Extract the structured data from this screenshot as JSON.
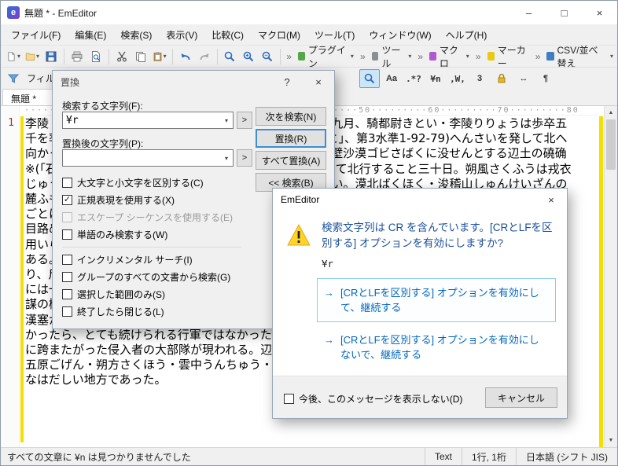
{
  "glyphs": {
    "caret": "▾",
    "chevron": "»",
    "help": "?",
    "close": "×",
    "minimize": "–",
    "maximize": "□",
    "check": "✓",
    "arrow": "→",
    "scroll_up": "▲",
    "scroll_down": "▼",
    "app_letter": "e"
  },
  "colors": {
    "accent_blue": "#3c8fd0",
    "instruction_blue": "#1a4f9c",
    "link_blue": "#0067c0",
    "warning_yellow": "#ffd32a",
    "modified_yellow": "#f3df00",
    "line_number_red": "#a33333"
  },
  "window": {
    "title": "無題 * - EmEditor"
  },
  "menu_bar": {
    "items": [
      "ファイル(F)",
      "編集(E)",
      "検索(S)",
      "表示(V)",
      "比較(C)",
      "マクロ(M)",
      "ツール(T)",
      "ウィンドウ(W)",
      "ヘルプ(H)"
    ]
  },
  "toolbar_main": {
    "labeled_buttons": [
      "プラグイン",
      "ツール",
      "マクロ",
      "マーカー",
      "CSV/並べ替え"
    ]
  },
  "toolbar_filter": {
    "label": "フィルター",
    "toggles": [
      "Aa",
      ".*?",
      "¥n",
      ",W,",
      "3",
      "↔",
      "¶"
    ]
  },
  "tab_bar": {
    "active_tab": "無題 *"
  },
  "editor": {
    "line_number": "1",
    "ruler": "·········10·········20·········30·········40·········50·········60·········70·········80",
    "text": "李陵 中島敦  一  漢かんの武帝ぶていの天漢てんかん二年秋九月、騎都尉きとい・李陵りりょうは歩卒五千を率ひきい、辺塞遮虜鄣しゃりょしょう※(「章+おおざと」、第3水準1-92-79)へんさいを発して北へ向かった。朔北の果て、阿爾泰アルタイ山脈の東南端が戈壁沙漠ゴビさばくに没せんとする辺土の磽确※(「石+角」、第3水準1-89-6)こうかくたる丘陵地帯を縫って北行すること三十日。朔風さくふうは戎衣じゅういを吹いて寒く、いかにも万里孤軍来たるの感が深い。漠北ばくほく・浚稽山しゅんけいざんの麓ふもとに到着すると、軍はそこに留とどまって営塁えいるいを築いた。北地の秋は既すでに深く、夜ごとに霜が降り、よく晴れた日には遥はるか北方に連なる山々の影が望まれた。営庭に立って望めば、目路めじの限り茫々ぼうぼうたる砂礫されきの海である。北辺の守りは薄く、烽火ほうかの台は久しく用いられなかった。わずか五千の歩卒を以もって騎馬戦を得意とする胡地こちの奥深くに侵入するのである。傍目はためには、これほど無謀な遠征はないと見えたであろう。いまや軍は敵地のただなかにあり、斥候は日ごとに遠く放たれた。情勢は予断を許さず、単于ぜんうの本隊の影はなお見えぬ。陵の軍には一頭の馬もなく(馬に跨またがる者は、陵とその幕僚のみ)、歩卒のみで行軍することからして、無謀の極きわみといわねばならぬ。後援はなく、しかもこの浚稽山しゅんけいざんからは、最寄もよりの漢塞かんさいからでも優に一千五百里(支那里程)はある。部下の信頼と峻厳しゅんげんたる軍律とがなかったら、とても続けられる行軍ではなかった。毎年秋風が立つと決きまって漢の北辺には、胡馬こばに跨またがった侵入者の大部隊が現われる。辺吏が殺され、人民が掠かすめられ、家畜が奪略される。五原ごげん・朔方さくほう・雲中うんちゅう・上谷じょうこく・雁門がんもんなどがその被害の最もはなはだしい地方であった。"
  },
  "replace_dialog": {
    "title": "置換",
    "find_label": "検索する文字列(F):",
    "find_value": "¥r",
    "replace_label": "置換後の文字列(P):",
    "replace_value": "",
    "expand_button": ">",
    "button_find_next": "次を検索(N)",
    "button_replace": "置換(R)",
    "button_replace_all": "すべて置換(A)",
    "button_collapse": "<< 検索(B)",
    "checkboxes": [
      {
        "label": "大文字と小文字を区別する(C)",
        "checked": false,
        "disabled": false
      },
      {
        "label": "正規表現を使用する(X)",
        "checked": true,
        "disabled": false
      },
      {
        "label": "エスケープ シーケンスを使用する(E)",
        "checked": false,
        "disabled": true
      },
      {
        "label": "単語のみ検索する(W)",
        "checked": false,
        "disabled": false
      },
      {
        "label": "インクリメンタル サーチ(I)",
        "checked": false,
        "disabled": false
      },
      {
        "label": "グループのすべての文書から検索(G)",
        "checked": false,
        "disabled": false
      },
      {
        "label": "選択した範囲のみ(S)",
        "checked": false,
        "disabled": false
      },
      {
        "label": "終了したら閉じる(L)",
        "checked": false,
        "disabled": false
      }
    ]
  },
  "message_dialog": {
    "title": "EmEditor",
    "instruction": "検索文字列は CR を含んでいます。[CRとLFを区別する] オプションを有効にしますか?",
    "detail": "¥r",
    "command_link_1": "[CRとLFを区別する] オプションを有効にして、継続する",
    "command_link_2": "[CRとLFを区別する] オプションを有効にしないで、継続する",
    "suppress_checkbox": "今後、このメッセージを表示しない(D)",
    "cancel_button": "キャンセル"
  },
  "status_bar": {
    "message": "すべての文章に ¥n は見つかりませんでした",
    "mode": "Text",
    "cursor": "1行, 1桁",
    "encoding": "日本語 (シフト JIS)"
  }
}
